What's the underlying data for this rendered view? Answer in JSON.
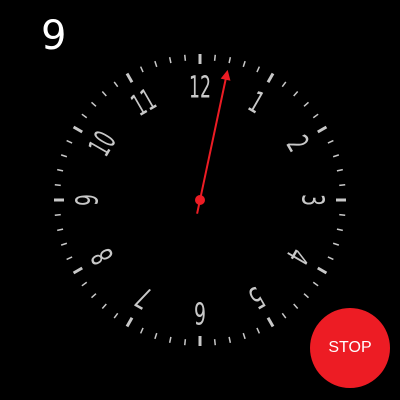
{
  "counter": {
    "value": "9"
  },
  "dial": {
    "numerals": [
      "12",
      "1",
      "2",
      "3",
      "4",
      "5",
      "6",
      "7",
      "8",
      "9",
      "10",
      "11"
    ],
    "hand_position_seconds": 2.0
  },
  "stop_button": {
    "label": "STOP"
  },
  "colors": {
    "background": "#000000",
    "dial": "#c8c8c8",
    "hand": "#ed1c24",
    "button": "#ed1c24",
    "text": "#ffffff"
  }
}
